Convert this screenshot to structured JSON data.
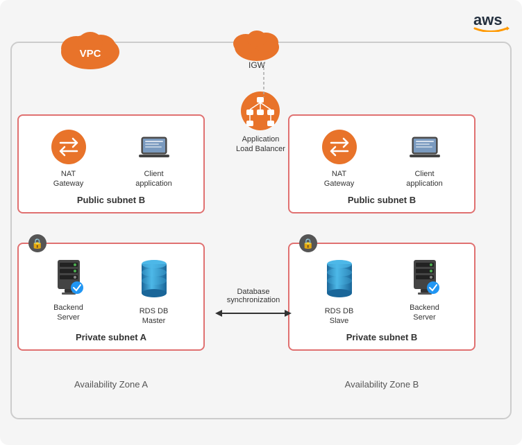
{
  "aws": {
    "logo_text": "aws",
    "smile": "~"
  },
  "vpc": {
    "label": "VPC"
  },
  "igw": {
    "label": "IGW"
  },
  "alb": {
    "label": "Application\nLoad Balancer"
  },
  "zone_a": {
    "public_subnet": "Public subnet B",
    "private_subnet": "Private subnet A",
    "zone_label": "Availability Zone A",
    "nat_gateway": "NAT\nGateway",
    "client_app": "Client\napplication",
    "backend_server": "Backend\nServer",
    "rds_master": "RDS DB\nMaster"
  },
  "zone_b": {
    "public_subnet": "Public subnet B",
    "private_subnet": "Private subnet B",
    "zone_label": "Availability Zone B",
    "nat_gateway": "NAT\nGateway",
    "client_app": "Client\napplication",
    "rds_slave": "RDS DB\nSlave",
    "backend_server": "Backend\nServer"
  },
  "sync": {
    "label": "Database\nsynchronization"
  }
}
